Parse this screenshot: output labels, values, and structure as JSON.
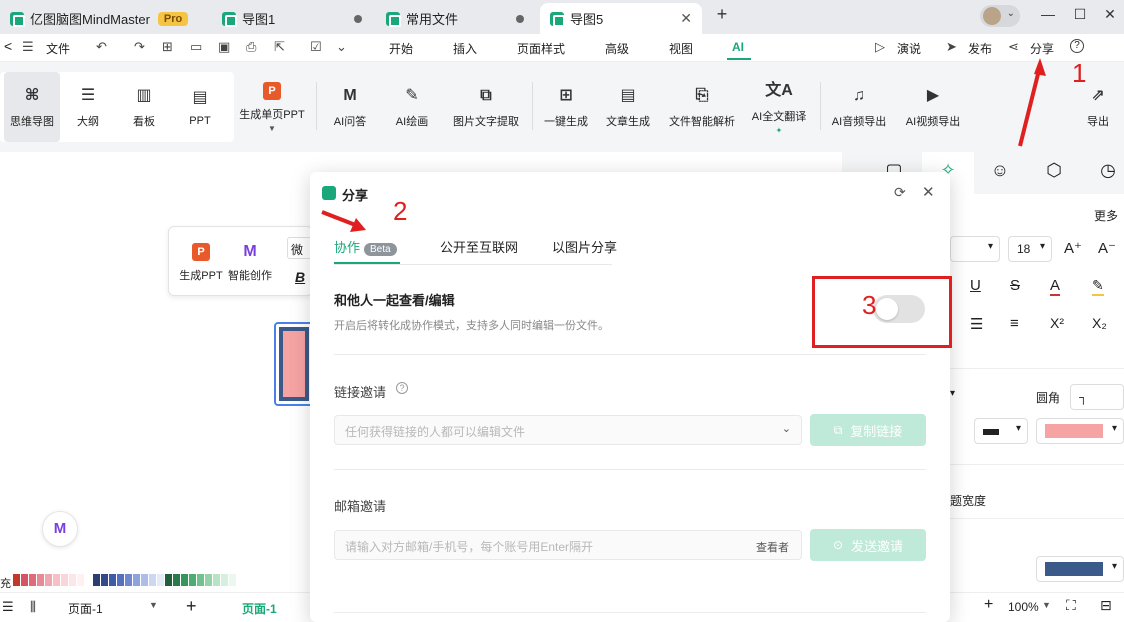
{
  "titlebar": {
    "app_tab": "亿图脑图MindMaster",
    "pro_badge": "Pro",
    "tabs": [
      {
        "label": "导图1"
      },
      {
        "label": "常用文件"
      },
      {
        "label": "导图5"
      }
    ],
    "new_tab": "+",
    "minimize": "—",
    "maximize": "☐",
    "close": "✕"
  },
  "menubar": {
    "back": "<",
    "file": "文件",
    "tabs": [
      "开始",
      "插入",
      "页面样式",
      "高级",
      "视图",
      "AI"
    ],
    "present": "演说",
    "publish": "发布",
    "share": "分享",
    "help": "?"
  },
  "ribbon": {
    "views": [
      "思维导图",
      "大纲",
      "看板",
      "PPT"
    ],
    "ai_tools": [
      "生成单页PPT",
      "AI问答",
      "AI绘画",
      "图片文字提取",
      "一键生成",
      "文章生成",
      "文件智能解析",
      "AI全文翻译",
      "AI音频导出",
      "AI视频导出"
    ],
    "export": "导出"
  },
  "canvas": {
    "float_toolbar": {
      "gen_ppt": "生成PPT",
      "smart_create": "智能创作",
      "font_preview": "微",
      "bold": "B"
    }
  },
  "statusbar": {
    "page_selector": "页面-1",
    "add_page": "+",
    "active_page": "页面-1",
    "zoom": "100%",
    "palette_label": "充"
  },
  "right_panel": {
    "more": "更多",
    "font_size": "18",
    "corner_label": "圆角",
    "width_label": "题宽度"
  },
  "dialog": {
    "title": "分享",
    "tabs": {
      "collab": "协作",
      "beta": "Beta",
      "public": "公开至互联网",
      "image": "以图片分享"
    },
    "collab_title": "和他人一起查看/编辑",
    "collab_desc": "开启后将转化成协作模式，支持多人同时编辑一份文件。",
    "link_invite": "链接邀请",
    "link_permission": "任何获得链接的人都可以编辑文件",
    "copy_link": "复制链接",
    "email_invite": "邮箱邀请",
    "email_placeholder": "请输入对方邮箱/手机号，每个账号用Enter隔开",
    "role": "查看者",
    "send_invite": "发送邀请",
    "toggle_on": false
  },
  "annotations": {
    "one": "1",
    "two": "2",
    "three": "3"
  },
  "colors": {
    "accent": "#1aa87a",
    "annotation": "#e02020"
  }
}
